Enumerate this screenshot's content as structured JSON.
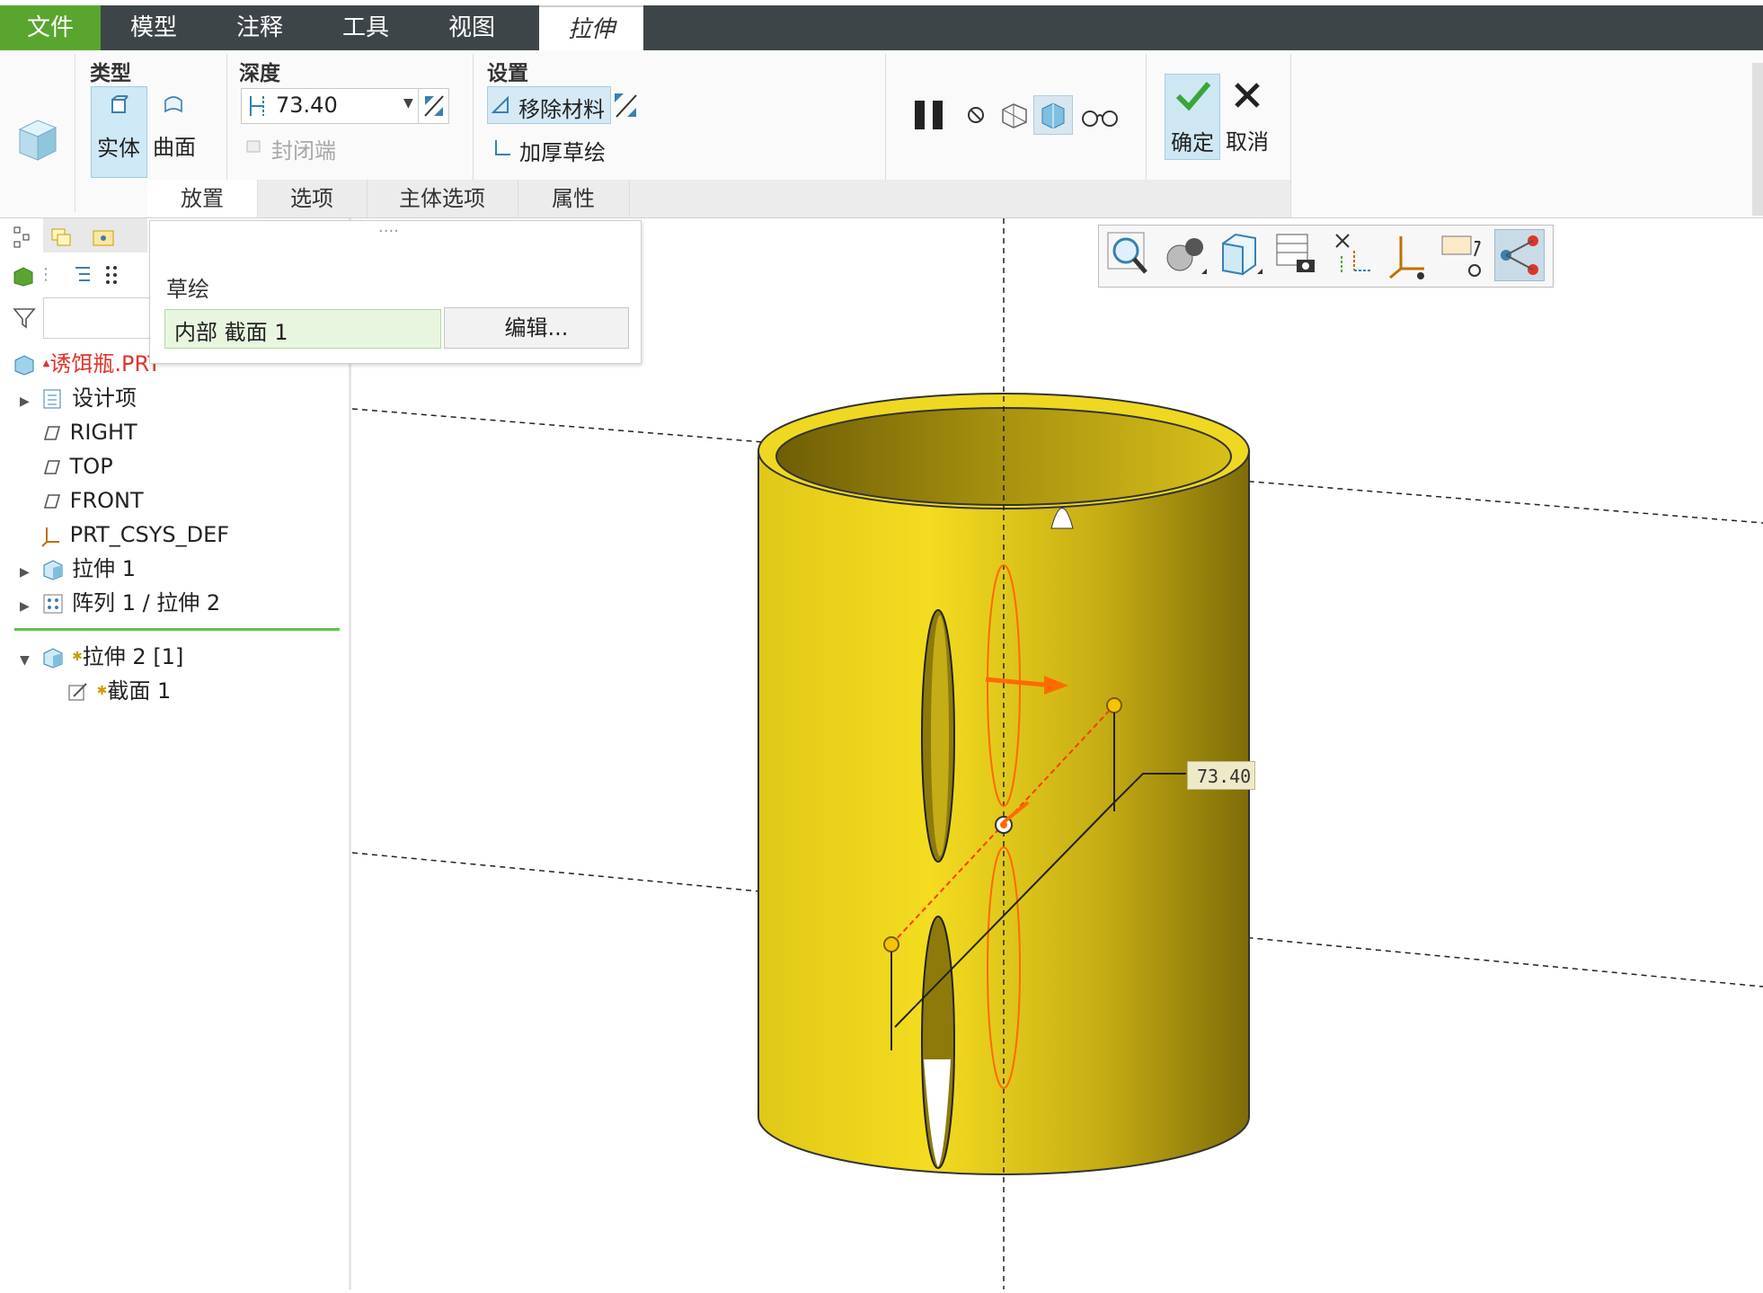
{
  "menu": {
    "items": [
      "文件",
      "模型",
      "注释",
      "工具",
      "视图",
      "拉伸"
    ]
  },
  "ribbon": {
    "type_group": {
      "title": "类型",
      "solid": "实体",
      "surface": "曲面"
    },
    "depth_group": {
      "title": "深度",
      "value": "73.40",
      "closed_ends": "封闭端"
    },
    "settings_group": {
      "title": "设置",
      "remove_material": "移除材料",
      "thicken_sketch": "加厚草绘"
    },
    "confirm": "确定",
    "cancel": "取消",
    "subtabs": [
      "放置",
      "选项",
      "主体选项",
      "属性"
    ]
  },
  "popup": {
    "handle": "....",
    "label": "草绘",
    "section_value": "内部 截面 1",
    "edit_button": "编辑..."
  },
  "tree": {
    "root": "诱饵瓶.PRT",
    "items": [
      {
        "label": "设计项",
        "icon": "design-items-icon"
      },
      {
        "label": "RIGHT",
        "icon": "datum-plane-icon"
      },
      {
        "label": "TOP",
        "icon": "datum-plane-icon"
      },
      {
        "label": "FRONT",
        "icon": "datum-plane-icon"
      },
      {
        "label": "PRT_CSYS_DEF",
        "icon": "csys-icon"
      },
      {
        "label": "拉伸 1",
        "icon": "extrude-icon"
      },
      {
        "label": "阵列 1 / 拉伸 2",
        "icon": "pattern-icon"
      }
    ],
    "active_feature": "拉伸 2 [1]",
    "active_child": "截面 1"
  },
  "viewport": {
    "dimension_label": "73.40"
  },
  "colors": {
    "menubar": "#3d4548",
    "file_menu": "#5aa530",
    "part_yellow": "#e8d21e",
    "sketch_orange": "#ff6a00",
    "tree_root_red": "#e0342b"
  }
}
